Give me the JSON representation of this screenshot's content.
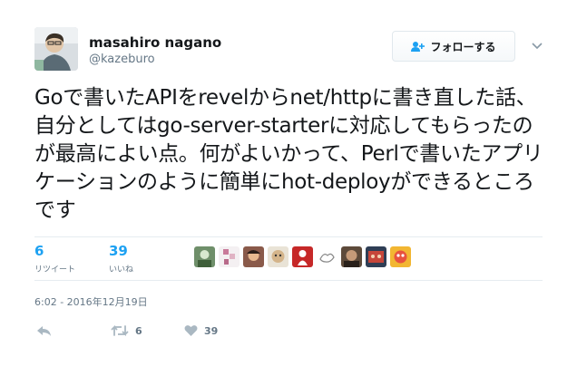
{
  "user": {
    "name": "masahiro nagano",
    "handle": "@kazeburo"
  },
  "follow": {
    "label": "フォローする"
  },
  "tweet": {
    "text": "Goで書いたAPIをrevelからnet/httpに書き直した話、自分としてはgo-server-starterに対応してもらったのが最高によい点。何がよいかって、Perlで書いたアプリケーションのように簡単にhot-deployができるところです"
  },
  "stats": {
    "retweets": {
      "count": "6",
      "label": "リツイート"
    },
    "likes": {
      "count": "39",
      "label": "いいね"
    }
  },
  "timestamp": "6:02 - 2016年12月19日",
  "actions": {
    "retweet_count": "6",
    "like_count": "39"
  },
  "colors": {
    "accent": "#1da1f2",
    "muted": "#657786",
    "divider": "#e6ecf0"
  }
}
